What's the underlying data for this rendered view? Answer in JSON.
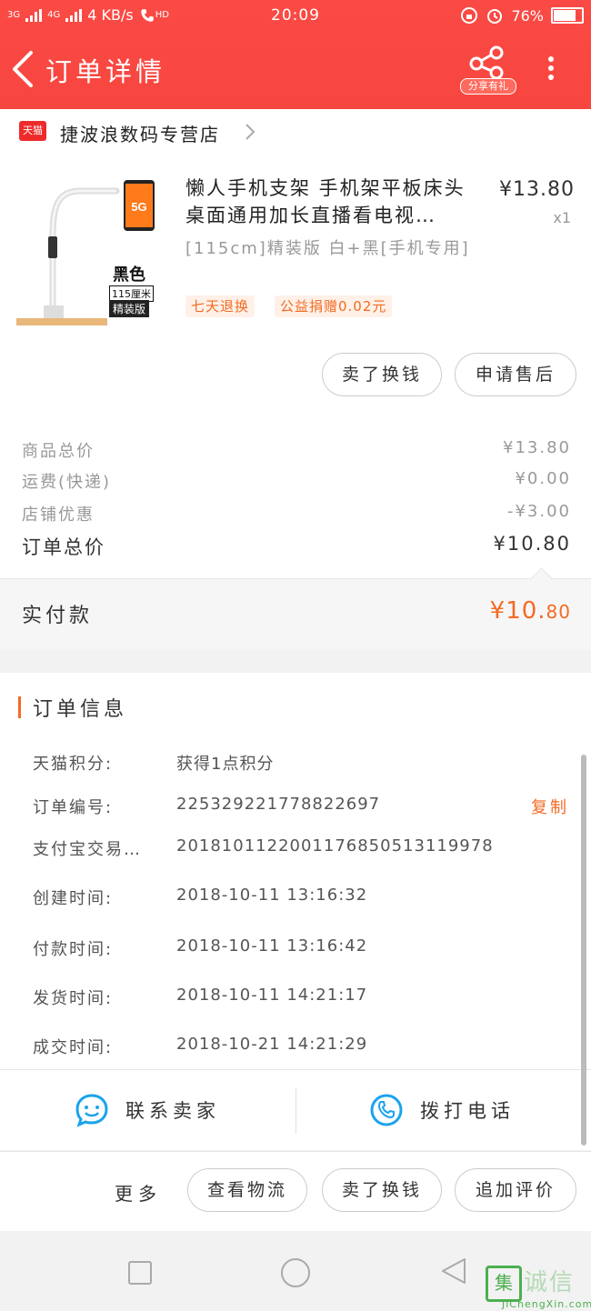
{
  "status_bar": {
    "network_left": "3G",
    "network_right": "4G",
    "speed": "4 KB/s",
    "hd": "HD",
    "time": "20:09",
    "battery": "76%"
  },
  "header": {
    "title": "订单详情",
    "share_label": "分享有礼"
  },
  "shop": {
    "badge": "天猫",
    "name": "捷波浪数码专营店"
  },
  "product": {
    "title": "懒人手机支架 手机架平板床头桌面通用加长直播看电视…",
    "sku": "[115cm]精装版 白+黑[手机专用]",
    "price": "¥13.80",
    "quantity": "x1",
    "image_color": "黑色",
    "image_size": "115厘米",
    "image_edition": "精装版",
    "tags": [
      "七天退换",
      "公益捐赠0.02元"
    ]
  },
  "product_actions": {
    "sell_label": "卖了换钱",
    "after_sale_label": "申请售后"
  },
  "totals": {
    "goods_label": "商品总价",
    "goods_value": "¥13.80",
    "shipping_label": "运费(快递)",
    "shipping_value": "¥0.00",
    "discount_label": "店铺优惠",
    "discount_value": "-¥3.00",
    "order_total_label": "订单总价",
    "order_total_value": "¥10.80"
  },
  "payment": {
    "label": "实付款",
    "value_major": "¥10.",
    "value_minor": "80"
  },
  "order_info": {
    "title": "订单信息",
    "copy_label": "复制",
    "rows": [
      {
        "label": "天猫积分:",
        "value": "获得1点积分"
      },
      {
        "label": "订单编号:",
        "value": "225329221778822697"
      },
      {
        "label": "支付宝交易…",
        "value": "2018101122001176850513119978"
      },
      {
        "label": "创建时间:",
        "value": "2018-10-11 13:16:32"
      },
      {
        "label": "付款时间:",
        "value": "2018-10-11 13:16:42"
      },
      {
        "label": "发货时间:",
        "value": "2018-10-11 14:21:17"
      },
      {
        "label": "成交时间:",
        "value": "2018-10-21 14:21:29"
      }
    ]
  },
  "contact": {
    "seller_label": "联系卖家",
    "call_label": "拨打电话"
  },
  "bottom_bar": {
    "more_label": "更多",
    "logistics_label": "查看物流",
    "sell_label": "卖了换钱",
    "review_label": "追加评价"
  },
  "watermark": {
    "glyph": "集",
    "text": "诚信",
    "url": "JiChengXin.com"
  },
  "colors": {
    "header": "#f7463f",
    "accent": "#f46a24",
    "tmall": "#ee2b2b",
    "icon_blue": "#1aa3ec"
  }
}
